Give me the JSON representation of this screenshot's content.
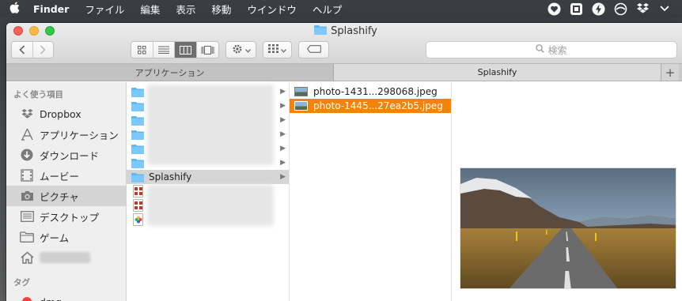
{
  "menubar": {
    "app_name": "Finder",
    "items": [
      "ファイル",
      "編集",
      "表示",
      "移動",
      "ウインドウ",
      "ヘルプ"
    ]
  },
  "window": {
    "title": "Splashify",
    "search_placeholder": "検索"
  },
  "tabs": [
    {
      "label": "アプリケーション"
    },
    {
      "label": "Splashify"
    }
  ],
  "sidebar": {
    "favorites_header": "よく使う項目",
    "items": [
      {
        "label": "Dropbox",
        "icon": "dropbox-icon"
      },
      {
        "label": "アプリケーション",
        "icon": "applications-icon"
      },
      {
        "label": "ダウンロード",
        "icon": "downloads-icon"
      },
      {
        "label": "ムービー",
        "icon": "movies-icon"
      },
      {
        "label": "ピクチャ",
        "icon": "pictures-icon"
      },
      {
        "label": "デスクトップ",
        "icon": "desktop-icon"
      },
      {
        "label": "ゲーム",
        "icon": "folder-icon"
      }
    ],
    "tags_header": "タグ",
    "tags": [
      {
        "label": "dmg",
        "color": "#fc3d39"
      }
    ]
  },
  "column1": {
    "selected_folder": "Splashify"
  },
  "column2": {
    "files": [
      {
        "name": "photo-1431...298068.jpeg"
      },
      {
        "name": "photo-1445...27ea2b5.jpeg"
      }
    ]
  },
  "colors": {
    "selection": "#f5830a",
    "folder": "#5fb8f5"
  }
}
